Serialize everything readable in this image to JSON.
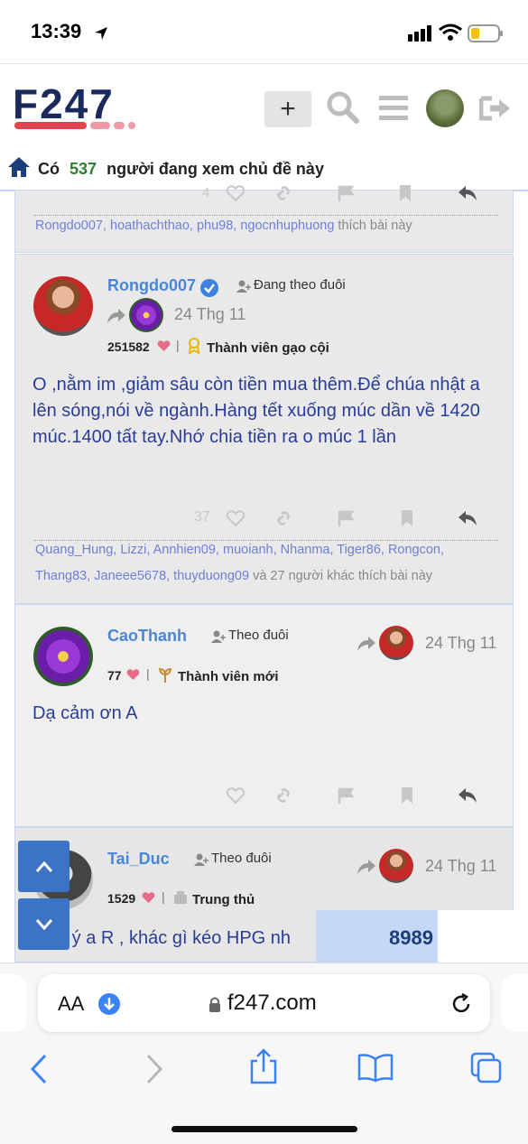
{
  "status": {
    "time": "13:39"
  },
  "header": {
    "logo_text": "F247",
    "plus_label": "+"
  },
  "viewer": {
    "prefix": "Có",
    "count": "537",
    "suffix": "người đang xem chủ đề này"
  },
  "post0": {
    "like_count": "4",
    "likers": "Rongdo007, hoathachthao, phu98, ngocnhuphuong",
    "likers_suffix": "thích bài này"
  },
  "post1": {
    "username": "Rongdo007",
    "follow": "Đang theo đuôi",
    "date": "24 Thg 11",
    "points": "251582",
    "rank": "Thành viên gạo cội",
    "content": "O ,nằm im ,giảm sâu còn tiền mua thêm.Để chúa nhật a lên sóng,nói về ngành.Hàng tết xuống múc dần về 1420 múc.1400 tất tay.Nhớ chia tiền ra o múc 1 lần",
    "like_count": "37",
    "likers": "Quang_Hung, Lizzi, Annhien09, muoianh, Nhanma, Tiger86, Rongcon, Thang83, Janeee5678, thuyduong09",
    "likers_suffix": "và 27 người khác thích bài này"
  },
  "post2": {
    "username": "CaoThanh",
    "follow": "Theo đuôi",
    "date": "24 Thg 11",
    "points": "77",
    "rank": "Thành viên mới",
    "content": "Dạ cảm ơn A"
  },
  "post3": {
    "username": "Tai_Duc",
    "follow": "Theo đuôi",
    "date": "24 Thg 11",
    "points": "1529",
    "rank": "Trung thủ",
    "content": "p ý a R , khác gì kéo HPG nh",
    "overlay_value": "8989"
  },
  "browser": {
    "aa_label": "AA",
    "url": "f247.com"
  },
  "colors": {
    "accent": "#3d73c7",
    "link": "#4a86d6",
    "viewer_count": "#2e7d32"
  }
}
